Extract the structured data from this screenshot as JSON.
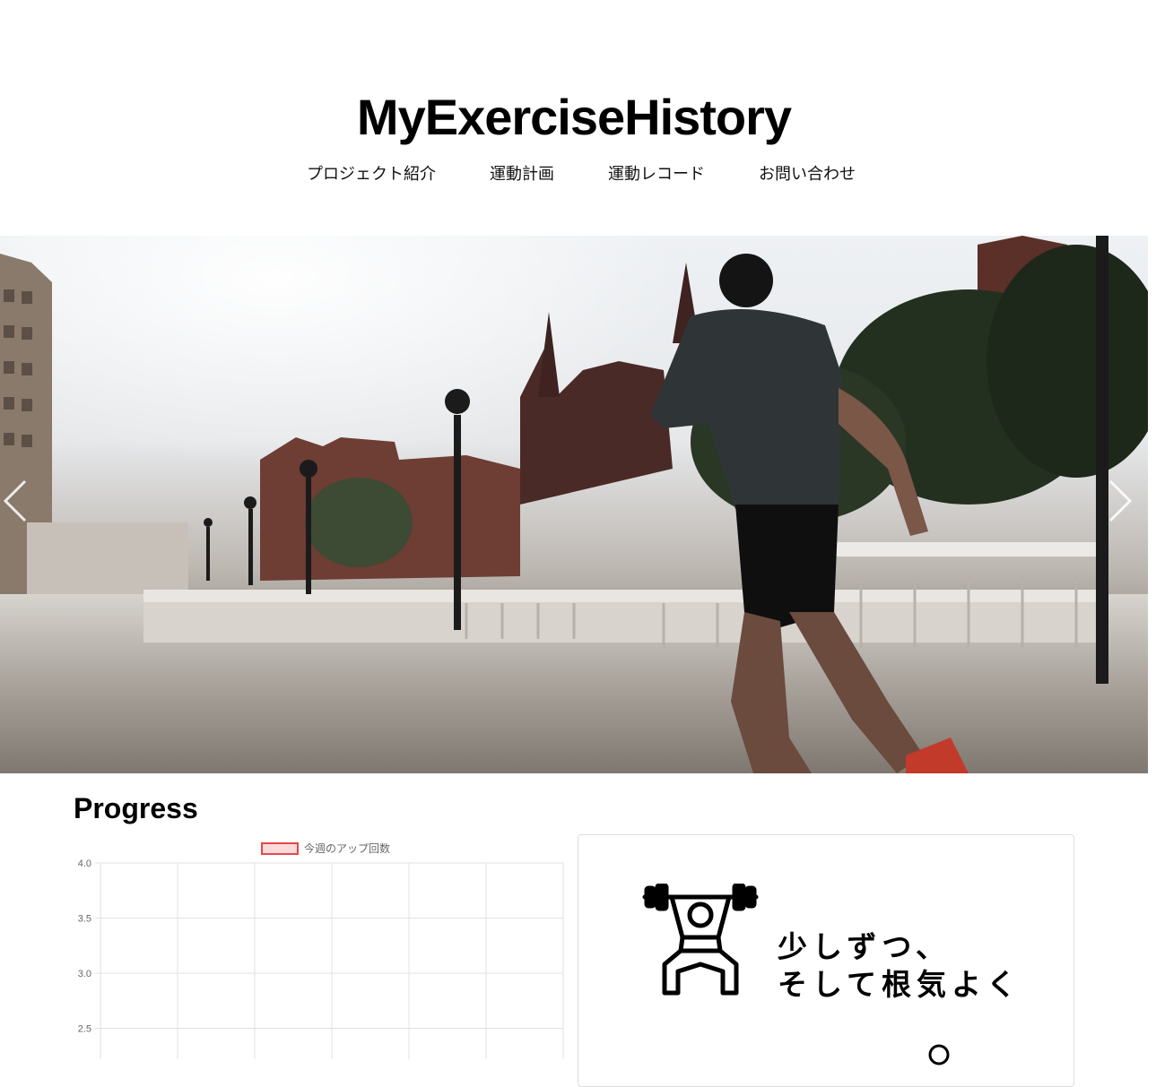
{
  "site": {
    "title": "MyExerciseHistory"
  },
  "nav": {
    "items": [
      {
        "label": "プロジェクト紹介"
      },
      {
        "label": "運動計画"
      },
      {
        "label": "運動レコード"
      },
      {
        "label": "お問い合わせ"
      }
    ]
  },
  "hero": {
    "icons": {
      "prev": "chevron-left-icon",
      "next": "chevron-right-icon"
    }
  },
  "progress": {
    "title": "Progress",
    "card": {
      "text": "少しずつ、\nそして根気よく",
      "icon": "weightlifter-icon"
    }
  },
  "chart_data": {
    "type": "line",
    "series": [
      {
        "name": "今週のアップ回数",
        "values": [],
        "color": "#e6474b"
      }
    ],
    "y_ticks": [
      "4.0",
      "3.5",
      "3.0",
      "2.5"
    ],
    "ylim_visible": [
      2.5,
      4.0
    ],
    "grid": true,
    "legend": "top-center"
  }
}
